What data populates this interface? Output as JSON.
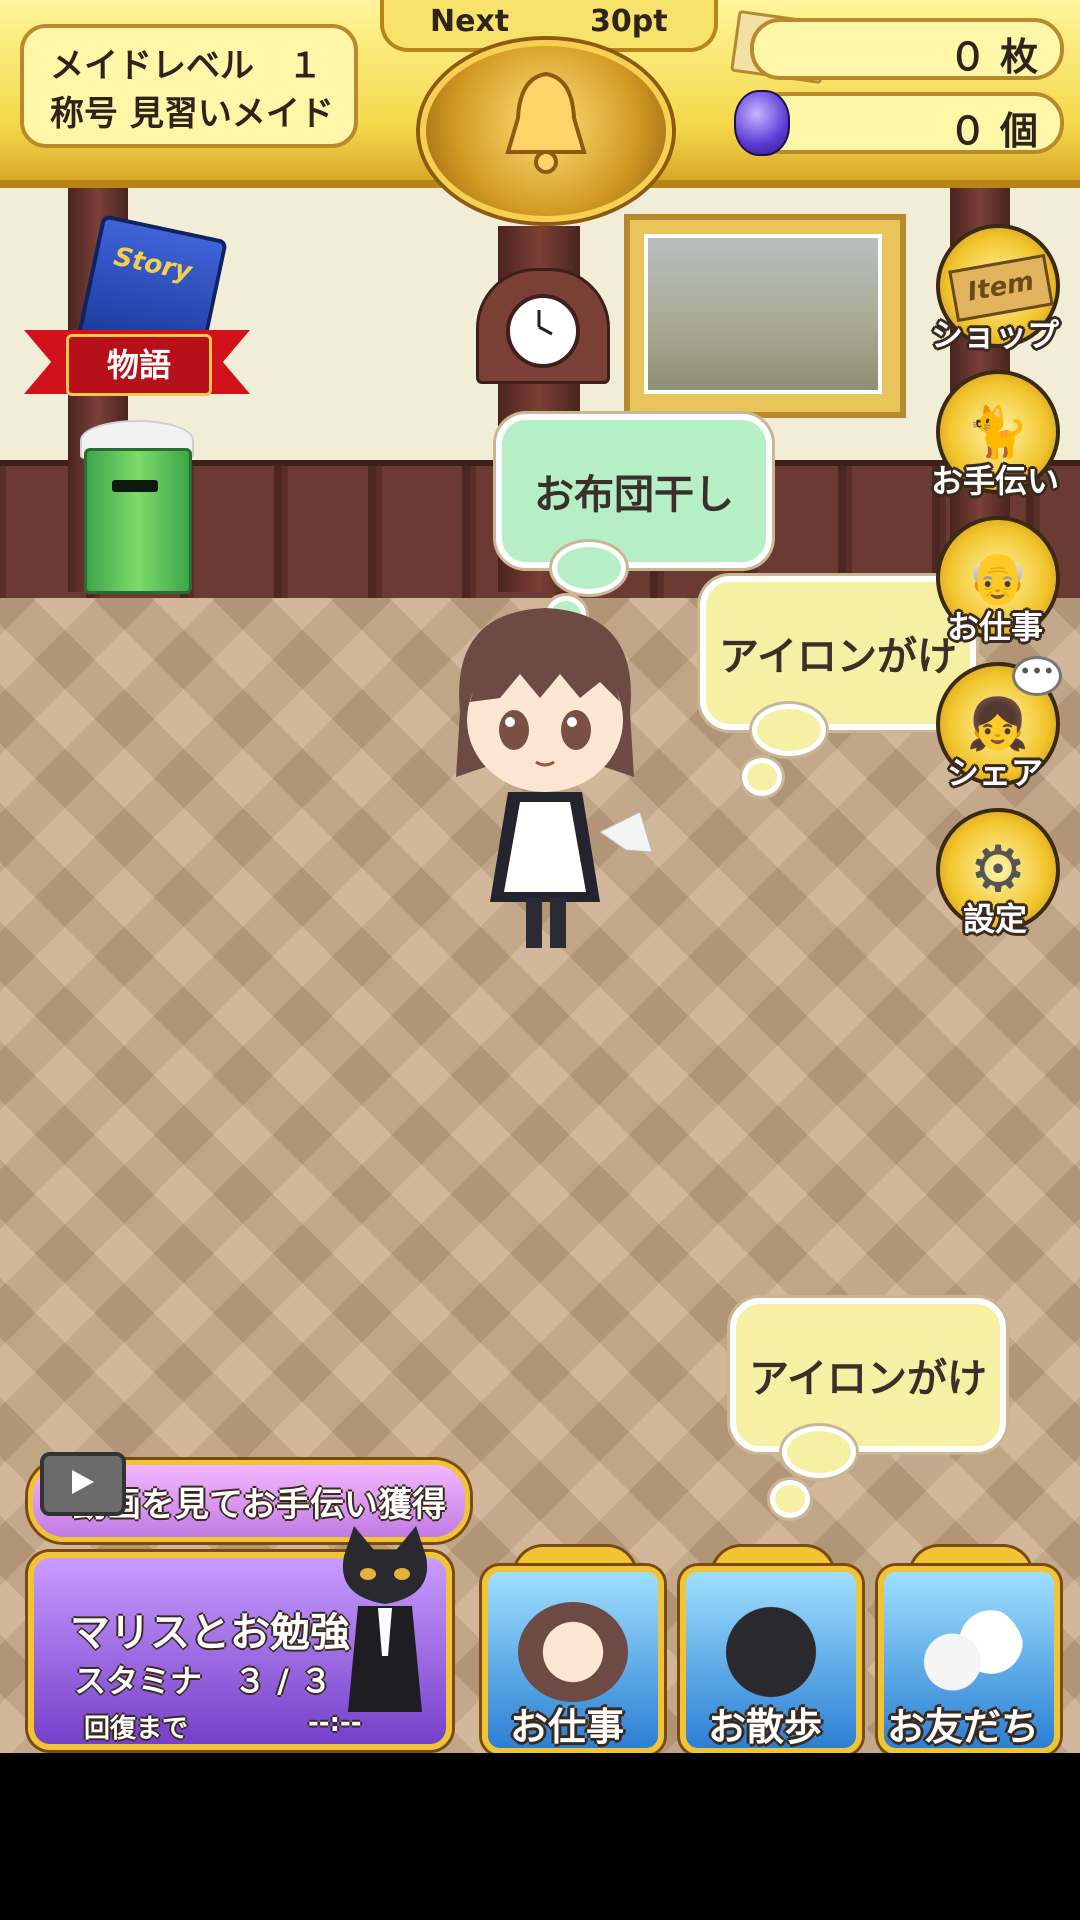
{
  "header": {
    "maid_level": "メイドレベル　１",
    "title": "称号 見習いメイド",
    "next_label": "Next",
    "next_points": "30pt",
    "tickets": "０ 枚",
    "gems": "０ 個"
  },
  "room": {
    "story_book_text": "Story",
    "story_label": "物語"
  },
  "bubbles": [
    {
      "text": "お布団干し",
      "color": "#b6efc6"
    },
    {
      "text": "アイロンがけ",
      "color": "#f6f0a4"
    },
    {
      "text": "アイロンがけ",
      "color": "#f6f0a4"
    }
  ],
  "side_menu": [
    {
      "label": "ショップ",
      "icon": "item-tag-icon",
      "tag": "Item"
    },
    {
      "label": "お手伝い",
      "icon": "black-cat-butler-icon"
    },
    {
      "label": "お仕事",
      "icon": "old-man-icon"
    },
    {
      "label": "シェア",
      "icon": "maid-face-icon"
    },
    {
      "label": "設定",
      "icon": "gear-icon"
    }
  ],
  "bottom": {
    "video_button": "動画を見てお手伝い獲得",
    "study_title": "マリスとお勉強",
    "stamina": "スタミナ　３ / ３",
    "recover_label": "回復まで",
    "recover_timer": "--:--"
  },
  "nav": [
    {
      "label": "お仕事",
      "icon": "maid-work-icon"
    },
    {
      "label": "お散歩",
      "icon": "black-cat-icon"
    },
    {
      "label": "お友だち",
      "icon": "cat-friends-icon"
    }
  ],
  "colors": {
    "accent_gold": "#f1c436",
    "top_bar": "#f4d84a",
    "panel_purple": "#7440c9",
    "nav_blue": "#2b7fd3"
  }
}
